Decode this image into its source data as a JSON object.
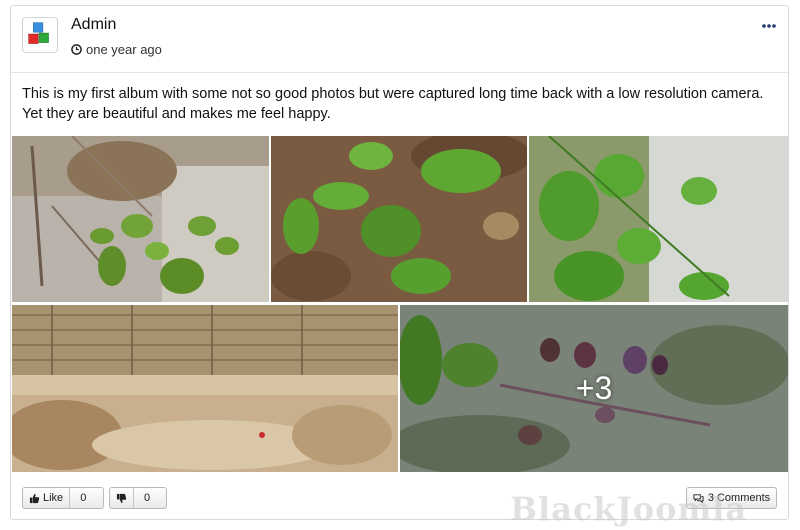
{
  "post": {
    "author": "Admin",
    "time": "one year ago",
    "text": "This is my first album with some not so good photos but were captured long time back with a low resolution camera. Yet they are beautiful and makes me feel happy."
  },
  "gallery": {
    "photos": [
      {
        "name": "photo-sapling-twigs"
      },
      {
        "name": "photo-leaves-soil"
      },
      {
        "name": "photo-vine-wall"
      },
      {
        "name": "photo-wood-soil"
      },
      {
        "name": "photo-purple-flowers"
      }
    ],
    "more_count": "+3"
  },
  "footer": {
    "like_label": "Like",
    "like_count": "0",
    "dislike_count": "0",
    "comments_label": "3 Comments"
  },
  "watermark": "BlackJoomla"
}
